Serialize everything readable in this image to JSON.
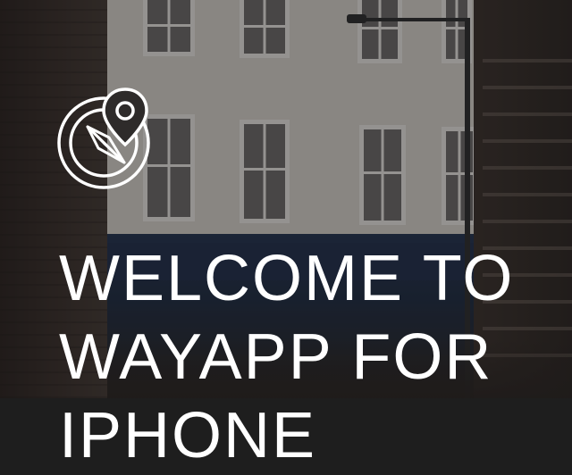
{
  "hero": {
    "logo_icon": "compass-location-pin-icon",
    "headline": {
      "line1": "WELCOME TO",
      "line2": "WAYAPP FOR",
      "line3": "IPHONE"
    }
  },
  "background": {
    "description": "street photo background"
  },
  "colors": {
    "text": "#ffffff",
    "overlay": "rgba(18,18,22,0.42)"
  }
}
